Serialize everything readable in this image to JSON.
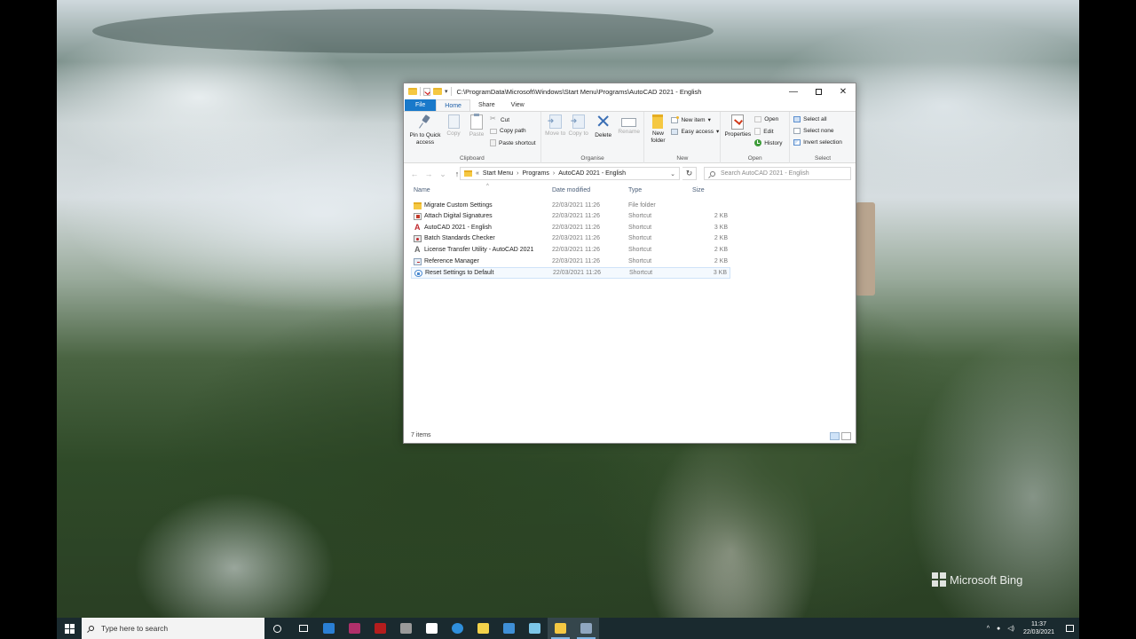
{
  "window": {
    "title": "C:\\ProgramData\\Microsoft\\Windows\\Start Menu\\Programs\\AutoCAD 2021 - English",
    "controls": {
      "minimize": "—",
      "close": "✕"
    }
  },
  "ribbon_tabs": [
    "File",
    "Home",
    "Share",
    "View"
  ],
  "ribbon": {
    "clipboard": {
      "label": "Clipboard",
      "pin": "Pin to Quick access",
      "copy": "Copy",
      "paste": "Paste",
      "cut": "Cut",
      "copy_path": "Copy path",
      "paste_shortcut": "Paste shortcut"
    },
    "organise": {
      "label": "Organise",
      "move_to": "Move to",
      "copy_to": "Copy to",
      "delete": "Delete",
      "rename": "Rename"
    },
    "new": {
      "label": "New",
      "new_folder": "New folder",
      "new_item": "New item",
      "easy_access": "Easy access"
    },
    "open": {
      "label": "Open",
      "properties": "Properties",
      "open": "Open",
      "edit": "Edit",
      "history": "History"
    },
    "select": {
      "label": "Select",
      "select_all": "Select all",
      "select_none": "Select none",
      "invert_selection": "Invert selection"
    }
  },
  "address": {
    "crumbs": [
      "Start Menu",
      "Programs",
      "AutoCAD 2021 - English"
    ],
    "prefix": "«",
    "search_placeholder": "Search AutoCAD 2021 - English"
  },
  "columns": {
    "name": "Name",
    "date": "Date modified",
    "type": "Type",
    "size": "Size"
  },
  "files": [
    {
      "name": "Migrate Custom Settings",
      "date": "22/03/2021 11:26",
      "type": "File folder",
      "size": "",
      "icon": "folder-icon"
    },
    {
      "name": "Attach Digital Signatures",
      "date": "22/03/2021 11:26",
      "type": "Shortcut",
      "size": "2 KB",
      "icon": "signature-icon"
    },
    {
      "name": "AutoCAD 2021 - English",
      "date": "22/03/2021 11:26",
      "type": "Shortcut",
      "size": "3 KB",
      "icon": "autocad-icon"
    },
    {
      "name": "Batch Standards Checker",
      "date": "22/03/2021 11:26",
      "type": "Shortcut",
      "size": "2 KB",
      "icon": "batch-checker-icon"
    },
    {
      "name": "License Transfer Utility - AutoCAD 2021",
      "date": "22/03/2021 11:26",
      "type": "Shortcut",
      "size": "2 KB",
      "icon": "license-icon"
    },
    {
      "name": "Reference Manager",
      "date": "22/03/2021 11:26",
      "type": "Shortcut",
      "size": "2 KB",
      "icon": "reference-manager-icon"
    },
    {
      "name": "Reset Settings to Default",
      "date": "22/03/2021 11:26",
      "type": "Shortcut",
      "size": "3 KB",
      "icon": "reset-icon"
    }
  ],
  "status": {
    "items": "7 items"
  },
  "watermark": {
    "text": "Microsoft Bing"
  },
  "taskbar": {
    "search_placeholder": "Type here to search",
    "pinned": [
      {
        "name": "mail",
        "color": "#2a7fd4"
      },
      {
        "name": "media-player",
        "color": "#b0306a"
      },
      {
        "name": "filezilla",
        "color": "#b41d1d"
      },
      {
        "name": "virtual-machine",
        "color": "#9a9a9a"
      },
      {
        "name": "wordpad",
        "color": "#ffffff"
      },
      {
        "name": "edge",
        "color": "#2f8fdc"
      },
      {
        "name": "sticky-notes",
        "color": "#f3d24a"
      },
      {
        "name": "control-panel",
        "color": "#3f8fd6"
      },
      {
        "name": "notes",
        "color": "#7cc6e8"
      },
      {
        "name": "file-explorer",
        "color": "#f5c842"
      },
      {
        "name": "autocad-setup",
        "color": "#8fa6c0"
      }
    ],
    "time": "11:37",
    "date": "22/03/2021"
  }
}
